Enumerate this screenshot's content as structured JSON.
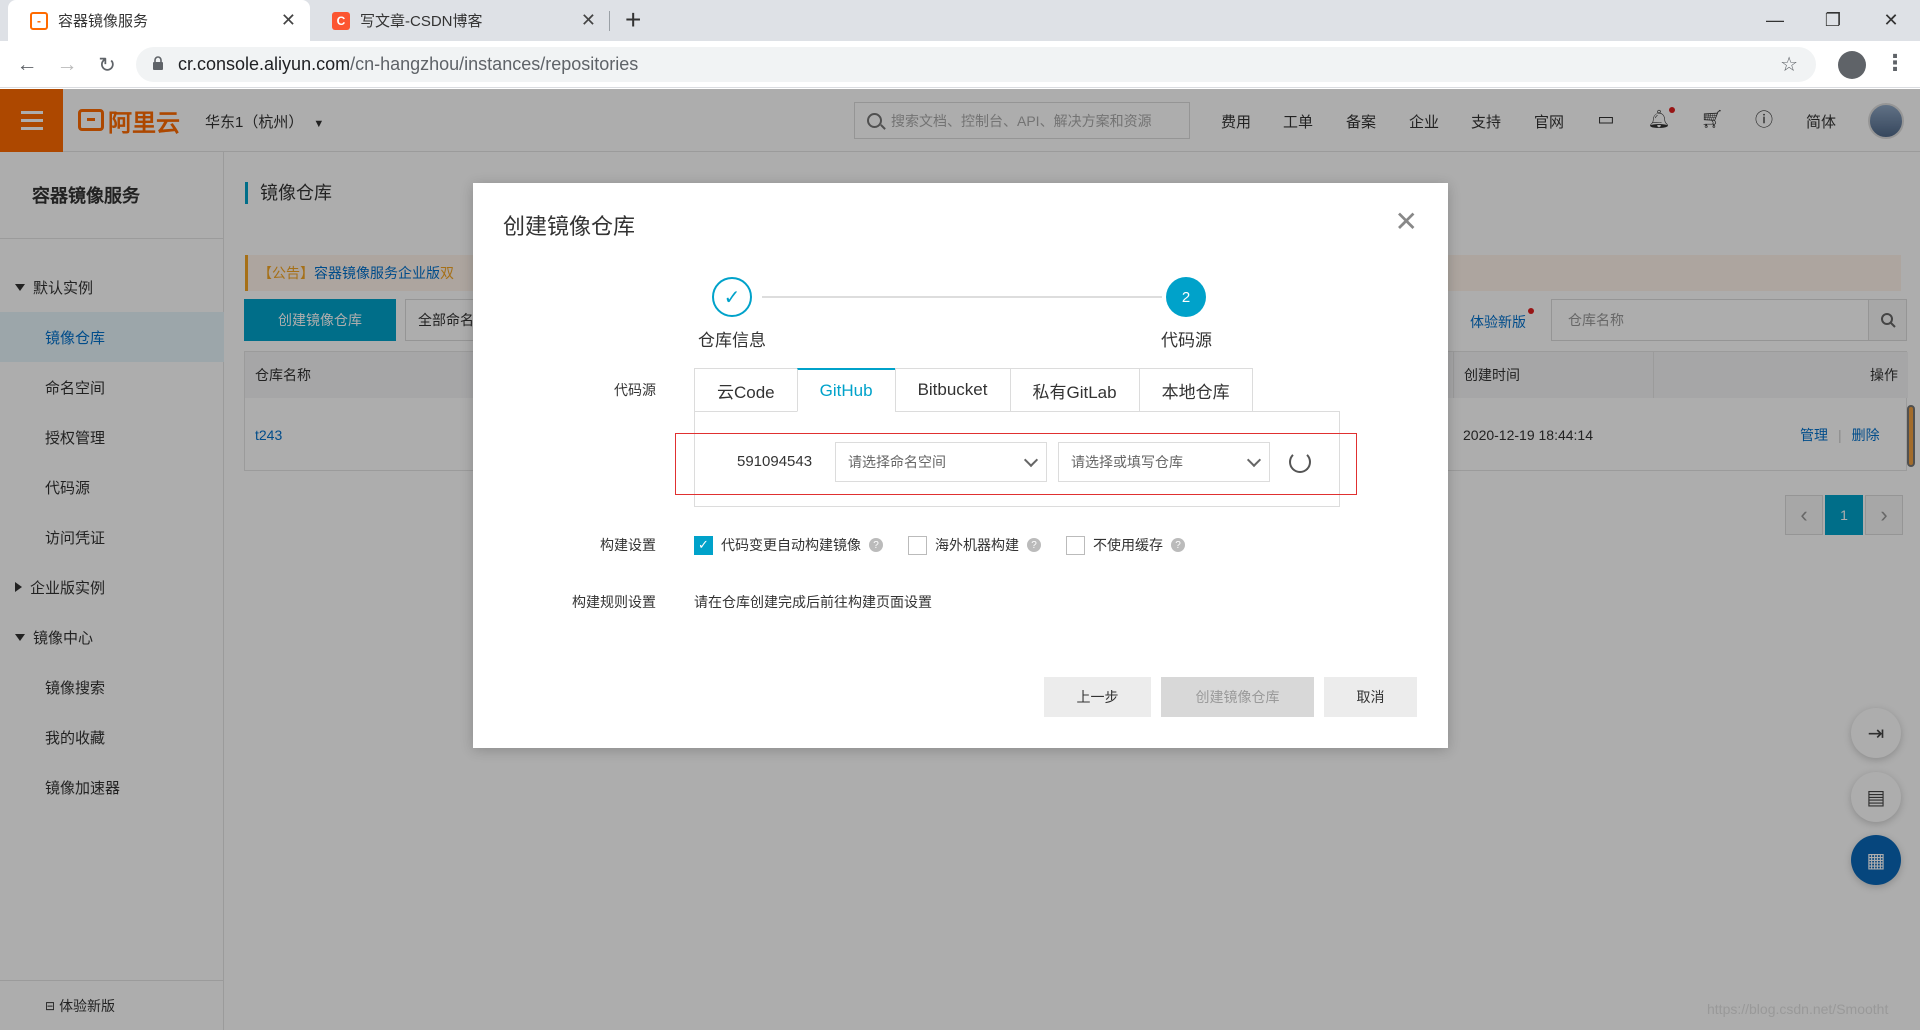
{
  "browser": {
    "tabs": [
      {
        "title": "容器镜像服务",
        "favicon": "aliyun-icon"
      },
      {
        "title": "写文章-CSDN博客",
        "favicon": "csdn-icon"
      }
    ],
    "url_host": "cr.console.aliyun.com",
    "url_path": "/cn-hangzhou/instances/repositories"
  },
  "header": {
    "brand": "阿里云",
    "region": "华东1（杭州）",
    "search_placeholder": "搜索文档、控制台、API、解决方案和资源",
    "nav": [
      "费用",
      "工单",
      "备案",
      "企业",
      "支持",
      "官网"
    ],
    "lang": "简体"
  },
  "sidebar": {
    "title": "容器镜像服务",
    "group1": "默认实例",
    "items1": [
      "镜像仓库",
      "命名空间",
      "授权管理",
      "代码源",
      "访问凭证"
    ],
    "group2": "企业版实例",
    "group3": "镜像中心",
    "items3": [
      "镜像搜索",
      "我的收藏",
      "镜像加速器"
    ],
    "bottom": "体验新版"
  },
  "content": {
    "title": "镜像仓库",
    "notice_prefix": "【公告】",
    "notice_link": "容器镜像服务企业版",
    "notice_suffix": "双",
    "create_button": "创建镜像仓库",
    "namespace_select": "全部命名",
    "new_version": "体验新版",
    "search_placeholder": "仓库名称",
    "table": {
      "headers": {
        "name": "仓库名称",
        "created": "创建时间",
        "actions": "操作"
      },
      "rows": [
        {
          "name": "t243",
          "created": "2020-12-19 18:44:14",
          "manage": "管理",
          "delete": "删除"
        }
      ]
    },
    "page": "1"
  },
  "modal": {
    "title": "创建镜像仓库",
    "steps": [
      {
        "label": "仓库信息",
        "state": "done"
      },
      {
        "label": "代码源",
        "number": "2",
        "state": "active"
      }
    ],
    "code_source_label": "代码源",
    "source_tabs": [
      "云Code",
      "GitHub",
      "Bitbucket",
      "私有GitLab",
      "本地仓库"
    ],
    "active_tab": "GitHub",
    "account": "591094543",
    "namespace_placeholder": "请选择命名空间",
    "repo_placeholder": "请选择或填写仓库",
    "build_settings_label": "构建设置",
    "options": [
      {
        "label": "代码变更自动构建镜像",
        "checked": true
      },
      {
        "label": "海外机器构建",
        "checked": false
      },
      {
        "label": "不使用缓存",
        "checked": false
      }
    ],
    "build_rules_label": "构建规则设置",
    "build_rules_text": "请在仓库创建完成后前往构建页面设置",
    "buttons": {
      "prev": "上一步",
      "create": "创建镜像仓库",
      "cancel": "取消"
    }
  },
  "watermark": "https://blog.csdn.net/Smootht",
  "colors": {
    "accent": "#00a2ca",
    "brand": "#ff6a00",
    "highlight": "#e03030"
  }
}
